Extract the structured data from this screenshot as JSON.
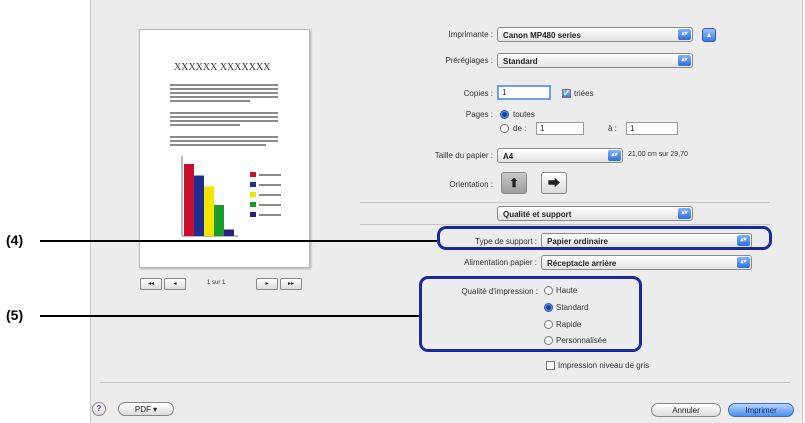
{
  "printer": {
    "label": "Imprimante :",
    "value": "Canon MP480 series"
  },
  "presets": {
    "label": "Préréglages :",
    "value": "Standard"
  },
  "copies": {
    "label": "Copies :",
    "value": "1",
    "collate_label": "triées"
  },
  "pages": {
    "label": "Pages :",
    "all_label": "toutes",
    "from_label": "de :",
    "from_value": "1",
    "to_label": "à :",
    "to_value": "1"
  },
  "paper_size": {
    "label": "Taille du papier :",
    "value": "A4",
    "dimensions": "21,00 cm sur 29,70"
  },
  "orientation": {
    "label": "Orientation :"
  },
  "panel": {
    "value": "Qualité et support"
  },
  "media_type": {
    "label": "Type de support :",
    "value": "Papier ordinaire"
  },
  "paper_source": {
    "label": "Alimentation papier :",
    "value": "Réceptacle arrière"
  },
  "print_quality": {
    "label": "Qualité d'impression :",
    "options": [
      "Haute",
      "Standard",
      "Rapide",
      "Personnalisée"
    ],
    "selected": "Standard"
  },
  "grayscale": {
    "label": "Impression niveau de gris"
  },
  "preview": {
    "heading": "XXXXXX XXXXXXX",
    "page_indicator": "1 sur 1",
    "bars": [
      {
        "value": 100,
        "color": "#c8102e"
      },
      {
        "value": 84,
        "color": "#1f2f8f"
      },
      {
        "value": 69,
        "color": "#f2e600"
      },
      {
        "value": 43,
        "color": "#1a9a2a"
      },
      {
        "value": 9,
        "color": "#2a1f80"
      }
    ]
  },
  "nav": {
    "first": "◂◂",
    "prev": "◂",
    "next": "▸",
    "last": "▸▸"
  },
  "footer": {
    "help": "?",
    "pdf_label": "PDF ▾",
    "cancel_label": "Annuler",
    "print_label": "Imprimer"
  },
  "callouts": {
    "four": "(4)",
    "five": "(5)"
  },
  "colors": {
    "accent": "#3b78e0",
    "callout_border": "#1a2a9a"
  }
}
